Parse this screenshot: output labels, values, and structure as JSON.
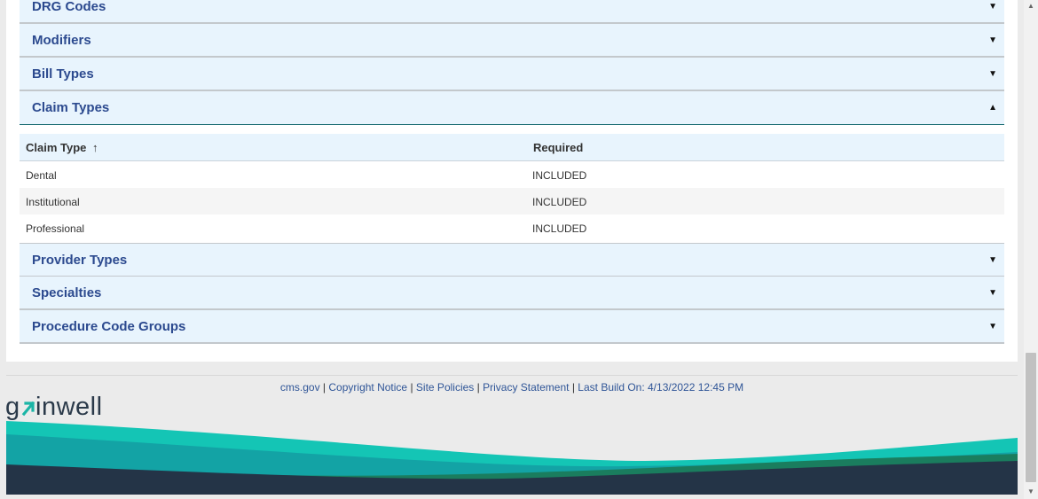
{
  "accordion": {
    "sections_top": [
      {
        "title": "DRG Codes",
        "arrow": "▼"
      },
      {
        "title": "Modifiers",
        "arrow": "▼"
      },
      {
        "title": "Bill Types",
        "arrow": "▼"
      },
      {
        "title": "Claim Types",
        "arrow": "▲"
      }
    ],
    "sections_bottom": [
      {
        "title": "Provider Types",
        "arrow": "▼"
      },
      {
        "title": "Specialties",
        "arrow": "▼"
      },
      {
        "title": "Procedure Code Groups",
        "arrow": "▼"
      }
    ]
  },
  "claim_types_table": {
    "headers": {
      "claim_type": "Claim Type",
      "sort_icon": "↑",
      "required": "Required"
    },
    "rows": [
      {
        "claim_type": "Dental",
        "required": "INCLUDED"
      },
      {
        "claim_type": "Institutional",
        "required": "INCLUDED"
      },
      {
        "claim_type": "Professional",
        "required": "INCLUDED"
      }
    ]
  },
  "footer": {
    "link_cms": "cms.gov",
    "sep": "|",
    "link_copyright": "Copyright Notice",
    "link_site_policies": "Site Policies",
    "link_privacy": "Privacy Statement",
    "build_info": "Last Build On: 4/13/2022 12:45 PM",
    "logo_text": "gainwell"
  },
  "colors": {
    "accordion_bg": "#e8f4fd",
    "accordion_title": "#2c4a8f",
    "wave_teal_light": "#14c5b5",
    "wave_teal": "#13a3a5",
    "wave_green": "#1a7d5e",
    "wave_navy": "#243447"
  }
}
